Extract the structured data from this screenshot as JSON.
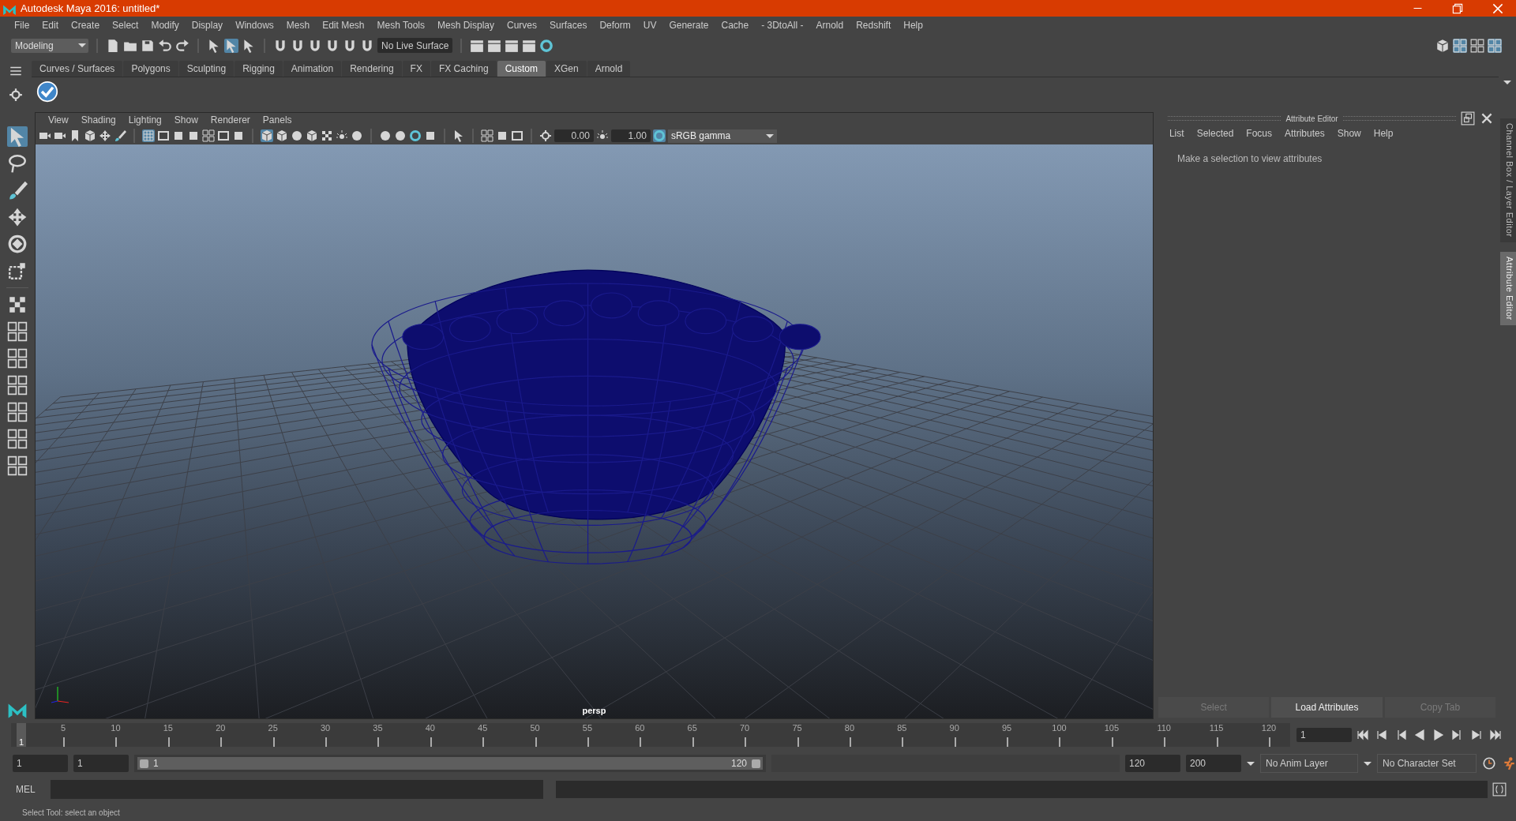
{
  "window": {
    "title": "Autodesk Maya 2016: untitled*"
  },
  "menu_bar": [
    "File",
    "Edit",
    "Create",
    "Select",
    "Modify",
    "Display",
    "Windows",
    "Mesh",
    "Edit Mesh",
    "Mesh Tools",
    "Mesh Display",
    "Curves",
    "Surfaces",
    "Deform",
    "UV",
    "Generate",
    "Cache",
    "- 3DtoAll -",
    "Arnold",
    "Redshift",
    "Help"
  ],
  "status_line": {
    "mode": "Modeling",
    "live_surface": "No Live Surface"
  },
  "shelf_tabs": [
    {
      "label": "Curves / Surfaces",
      "selected": false
    },
    {
      "label": "Polygons",
      "selected": false
    },
    {
      "label": "Sculpting",
      "selected": false
    },
    {
      "label": "Rigging",
      "selected": false
    },
    {
      "label": "Animation",
      "selected": false
    },
    {
      "label": "Rendering",
      "selected": false
    },
    {
      "label": "FX",
      "selected": false
    },
    {
      "label": "FX Caching",
      "selected": false
    },
    {
      "label": "Custom",
      "selected": true
    },
    {
      "label": "XGen",
      "selected": false
    },
    {
      "label": "Arnold",
      "selected": false
    }
  ],
  "viewport": {
    "menus": [
      "View",
      "Shading",
      "Lighting",
      "Show",
      "Renderer",
      "Panels"
    ],
    "exposure": "0.00",
    "gamma": "1.00",
    "color_space": "sRGB gamma",
    "camera": "persp"
  },
  "attribute_editor": {
    "title": "Attribute Editor",
    "menus": [
      "List",
      "Selected",
      "Focus",
      "Attributes",
      "Show",
      "Help"
    ],
    "message": "Make a selection to view attributes",
    "buttons": [
      {
        "label": "Select",
        "disabled": true
      },
      {
        "label": "Load Attributes",
        "disabled": false
      },
      {
        "label": "Copy Tab",
        "disabled": true
      }
    ]
  },
  "side_tabs": [
    {
      "label": "Channel Box / Layer Editor",
      "selected": false
    },
    {
      "label": "Attribute Editor",
      "selected": true
    }
  ],
  "time_slider": {
    "ticks": [
      "5",
      "10",
      "15",
      "20",
      "25",
      "30",
      "35",
      "40",
      "45",
      "50",
      "55",
      "60",
      "65",
      "70",
      "75",
      "80",
      "85",
      "90",
      "95",
      "100",
      "105",
      "110",
      "115",
      "120"
    ],
    "current_frame": "1",
    "frame_field": "1",
    "level": 0
  },
  "range_slider": {
    "start": "1",
    "playback_start": "1",
    "level": 1,
    "range_start": "1",
    "range_end": "120",
    "playback_end": "120",
    "end": "200",
    "anim_layer": "No Anim Layer",
    "character_set": "No Character Set"
  },
  "command_line": {
    "label": "MEL"
  },
  "help_line": "Select Tool: select an object"
}
